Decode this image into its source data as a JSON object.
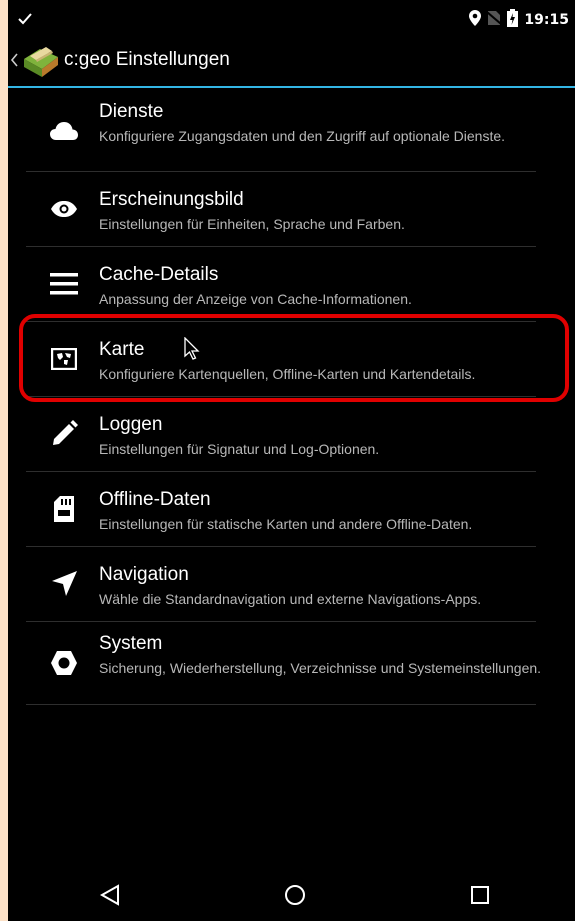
{
  "status_bar": {
    "time": "19:15",
    "icons": [
      "check-icon",
      "location-icon",
      "no-sim-icon",
      "battery-charging-icon"
    ]
  },
  "action_bar": {
    "title": "c:geo Einstellungen",
    "icons": [
      "back-caret-icon",
      "cgeo-logo-icon"
    ]
  },
  "accent_color": "#33b5e5",
  "highlight_color": "#e00000",
  "settings": [
    {
      "title": "Dienste",
      "summary": "Konfiguriere Zugangsdaten und den Zugriff auf optionale Dienste.",
      "icon": "cloud-icon"
    },
    {
      "title": "Erscheinungsbild",
      "summary": "Einstellungen für Einheiten, Sprache und Farben.",
      "icon": "eye-icon"
    },
    {
      "title": "Cache-Details",
      "summary": "Anpassung der Anzeige von Cache-Informationen.",
      "icon": "list-icon"
    },
    {
      "title": "Karte",
      "summary": "Konfiguriere Kartenquellen, Offline-Karten und Kartendetails.",
      "icon": "map-icon"
    },
    {
      "title": "Loggen",
      "summary": "Einstellungen für Signatur und Log-Optionen.",
      "icon": "pencil-icon"
    },
    {
      "title": "Offline-Daten",
      "summary": "Einstellungen für statische Karten und andere Offline-Daten.",
      "icon": "sd-card-icon"
    },
    {
      "title": "Navigation",
      "summary": "Wähle die Standardnavigation und externe Navigations-Apps.",
      "icon": "navigation-arrow-icon"
    },
    {
      "title": "System",
      "summary": "Sicherung, Wiederherstellung, Verzeichnisse und Systemeinstellungen.",
      "icon": "hexagon-icon"
    }
  ],
  "nav_bar": [
    "back-triangle-icon",
    "home-circle-icon",
    "recents-square-icon"
  ]
}
